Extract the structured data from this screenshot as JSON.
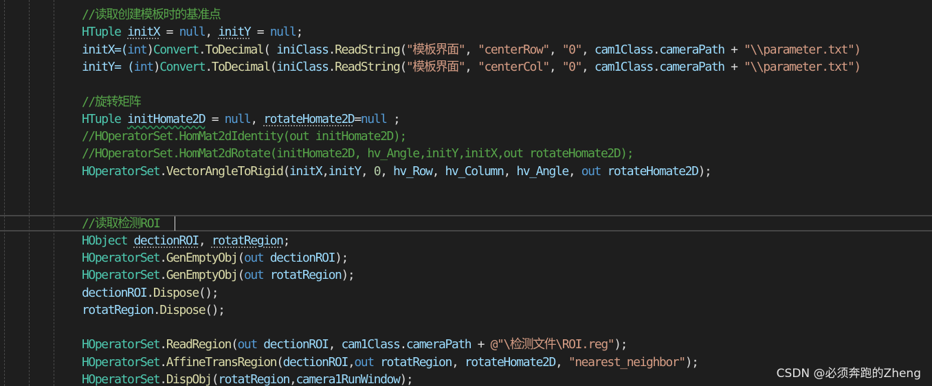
{
  "code": {
    "l1_comment": "//读取创建模板时的基准点",
    "l2": {
      "type": "HTuple",
      "var1": "initX",
      "eq1": " = ",
      "null1": "null",
      "comma": ", ",
      "var2": "initY",
      "eq2": " = ",
      "null2": "null",
      "end": ";"
    },
    "l3": {
      "lhs": "initX=(",
      "int": "int",
      ")": ")",
      "conv": "Convert",
      "dot1": ".",
      "todec": "ToDecimal",
      "open": "( ",
      "ini": "iniClass",
      "dot2": ".",
      "rs": "ReadString",
      "args_open": "(",
      "s1": "\"模板界面\"",
      "c1": ", ",
      "s2": "\"centerRow\"",
      "c2": ", ",
      "s3": "\"0\"",
      "c3": ", ",
      "cam": "cam1Class",
      "dot3": ".",
      "path": "cameraPath",
      "plus": " + ",
      "s4": "\"\\\\parameter.txt\")"
    },
    "l4": {
      "lhs": "initY= (",
      "int": "int",
      ")": ")",
      "conv": "Convert",
      "dot1": ".",
      "todec": "ToDecimal",
      "open": "(",
      "ini": "iniClass",
      "dot2": ".",
      "rs": "ReadString",
      "args_open": "(",
      "s1": "\"模板界面\"",
      "c1": ", ",
      "s2": "\"centerCol\"",
      "c2": ", ",
      "s3": "\"0\"",
      "c3": ", ",
      "cam": "cam1Class",
      "dot3": ".",
      "path": "cameraPath",
      "plus": " + ",
      "s4": "\"\\\\parameter.txt\")"
    },
    "l6_comment": "//旋转矩阵",
    "l7": {
      "type": "HTuple",
      "var1": "initHomate2D",
      "eq1": " = ",
      "null1": "null",
      "comma": ", ",
      "var2": "rotateHomate2D",
      "eq2": "=",
      "null2": "null",
      "end": " ;"
    },
    "l8_comment": "//HOperatorSet.HomMat2dIdentity(out initHomate2D);",
    "l9_comment": "//HOperatorSet.HomMat2dRotate(initHomate2D, hv_Angle,initY,initX,out rotateHomate2D);",
    "l10": {
      "cls": "HOperatorSet",
      "dot": ".",
      "fn": "VectorAngleToRigid",
      "open": "(",
      "a1": "initX",
      "c1": ",",
      "a2": "initY",
      "c2": ", ",
      "num": "0",
      "c3": ", ",
      "a3": "hv_Row",
      "c4": ", ",
      "a4": "hv_Column",
      "c5": ", ",
      "a5": "hv_Angle",
      "c6": ", ",
      "out": "out",
      "sp": " ",
      "a6": "rotateHomate2D",
      "close": ");"
    },
    "l13_comment": "//读取检测ROI",
    "l14": {
      "type": "HObject",
      "sp": " ",
      "var1": "dectionROI",
      "comma": ", ",
      "var2": "rotatRegion",
      "end": ";"
    },
    "l15": {
      "cls": "HOperatorSet",
      "dot": ".",
      "fn": "GenEmptyObj",
      "open": "(",
      "out": "out",
      "sp": " ",
      "arg": "dectionROI",
      "close": ");"
    },
    "l16": {
      "cls": "HOperatorSet",
      "dot": ".",
      "fn": "GenEmptyObj",
      "open": "(",
      "out": "out",
      "sp": " ",
      "arg": "rotatRegion",
      "close": ");"
    },
    "l17": {
      "obj": "dectionROI",
      "dot": ".",
      "fn": "Dispose",
      "close": "();"
    },
    "l18": {
      "obj": "rotatRegion",
      "dot": ".",
      "fn": "Dispose",
      "close": "();"
    },
    "l20": {
      "cls": "HOperatorSet",
      "dot": ".",
      "fn": "ReadRegion",
      "open": "(",
      "out": "out",
      "sp": " ",
      "a1": "dectionROI",
      "c1": ", ",
      "cam": "cam1Class",
      "dot2": ".",
      "path": "cameraPath",
      "plus": " + ",
      "str": "@\"\\检测文件\\ROI.reg\"",
      "close": ");"
    },
    "l21": {
      "cls": "HOperatorSet",
      "dot": ".",
      "fn": "AffineTransRegion",
      "open": "(",
      "a1": "dectionROI",
      "c1": ",",
      "out": "out",
      "sp": " ",
      "a2": "rotatRegion",
      "c2": ", ",
      "a3": "rotateHomate2D",
      "c3": ", ",
      "str": "\"nearest_neighbor\"",
      "close": ");"
    },
    "l22": {
      "cls": "HOperatorSet",
      "dot": ".",
      "fn": "DispObj",
      "open": "(",
      "a1": "rotatRegion",
      "c1": ",",
      "a2": "camera1RunWindow",
      "close": ");"
    }
  },
  "watermark": "CSDN @必须奔跑的Zheng",
  "colors": {
    "background": "#1e1e1e",
    "comment": "#57a64a",
    "type": "#4ec9b0",
    "keyword": "#569cd6",
    "variable": "#9cdcfe",
    "string": "#d69d85",
    "method": "#dcdcaa"
  }
}
